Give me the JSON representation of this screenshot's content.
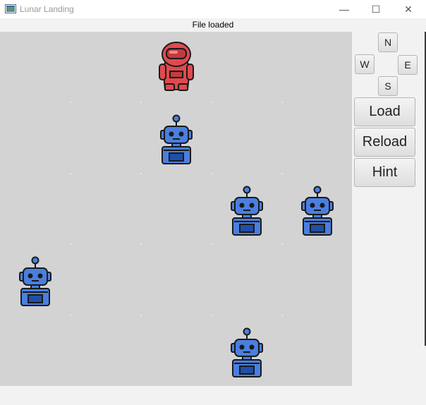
{
  "window": {
    "title": "Lunar Landing",
    "minimize_glyph": "—",
    "maximize_glyph": "☐",
    "close_glyph": "✕"
  },
  "status": "File loaded",
  "board": {
    "columns": 5,
    "rows": 5,
    "pieces": [
      {
        "type": "astronaut",
        "row": 0,
        "col": 2
      },
      {
        "type": "robot",
        "row": 1,
        "col": 2
      },
      {
        "type": "robot",
        "row": 2,
        "col": 3
      },
      {
        "type": "robot",
        "row": 2,
        "col": 4
      },
      {
        "type": "robot",
        "row": 3,
        "col": 0
      },
      {
        "type": "robot",
        "row": 4,
        "col": 3
      }
    ],
    "colors": {
      "board": "#d3d3d3",
      "astronaut": "#e04a4f",
      "robot": "#4a7fe0"
    }
  },
  "controls": {
    "north": "N",
    "west": "W",
    "east": "E",
    "south": "S",
    "load": "Load",
    "reload": "Reload",
    "hint": "Hint"
  }
}
